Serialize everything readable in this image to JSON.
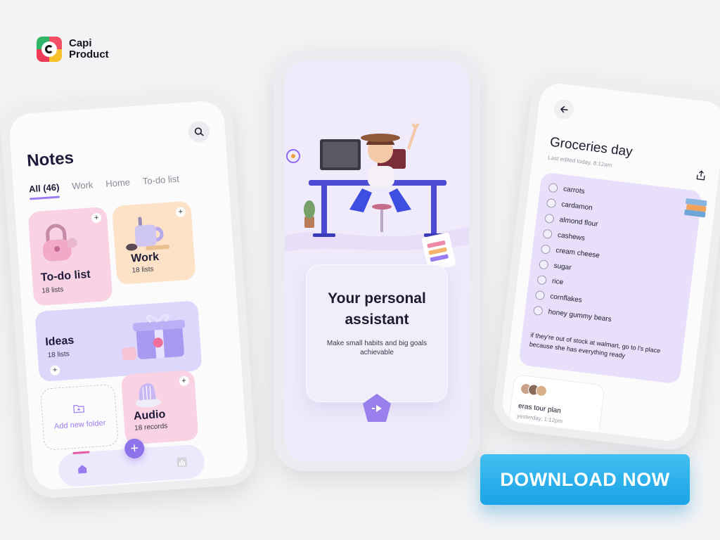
{
  "brand": {
    "line1": "Capi",
    "line2": "Product"
  },
  "notes_app": {
    "title": "Notes",
    "tabs": [
      {
        "label": "All (46)",
        "active": true
      },
      {
        "label": "Work"
      },
      {
        "label": "Home"
      },
      {
        "label": "To-do list"
      }
    ],
    "cards": {
      "todo": {
        "title": "To-do list",
        "count": "18 lists",
        "color": "#f9d3e3"
      },
      "work": {
        "title": "Work",
        "count": "18 lists",
        "color": "#fde2c7"
      },
      "ideas": {
        "title": "Ideas",
        "count": "18 lists",
        "color": "#ddd8fb"
      },
      "add_folder": {
        "label": "Add new folder"
      },
      "audio": {
        "title": "Audio",
        "count": "18 records",
        "color": "#f9d3e3"
      }
    },
    "plus_symbol": "+",
    "fab_symbol": "+",
    "accent": "#8d72ea"
  },
  "onboarding": {
    "title_line1": "Your personal",
    "title_line2": "assistant",
    "subtitle": "Make small habits and big goals achievable"
  },
  "groceries": {
    "title": "Groceries day",
    "last_edited": "Last edited today, 8:12am",
    "items": [
      "carrots",
      "cardamon",
      "almond flour",
      "cashews",
      "cream cheese",
      "sugar",
      "rice",
      "cornflakes",
      "honey gummy bears"
    ],
    "note": "if they're out of stock at walmart, go to l's place because she has everything ready",
    "next_note": {
      "title": "eras tour plan",
      "date": "yesterday, 1:12pm"
    }
  },
  "cta": {
    "label": "DOWNLOAD NOW",
    "color": "#1aa3e6"
  }
}
